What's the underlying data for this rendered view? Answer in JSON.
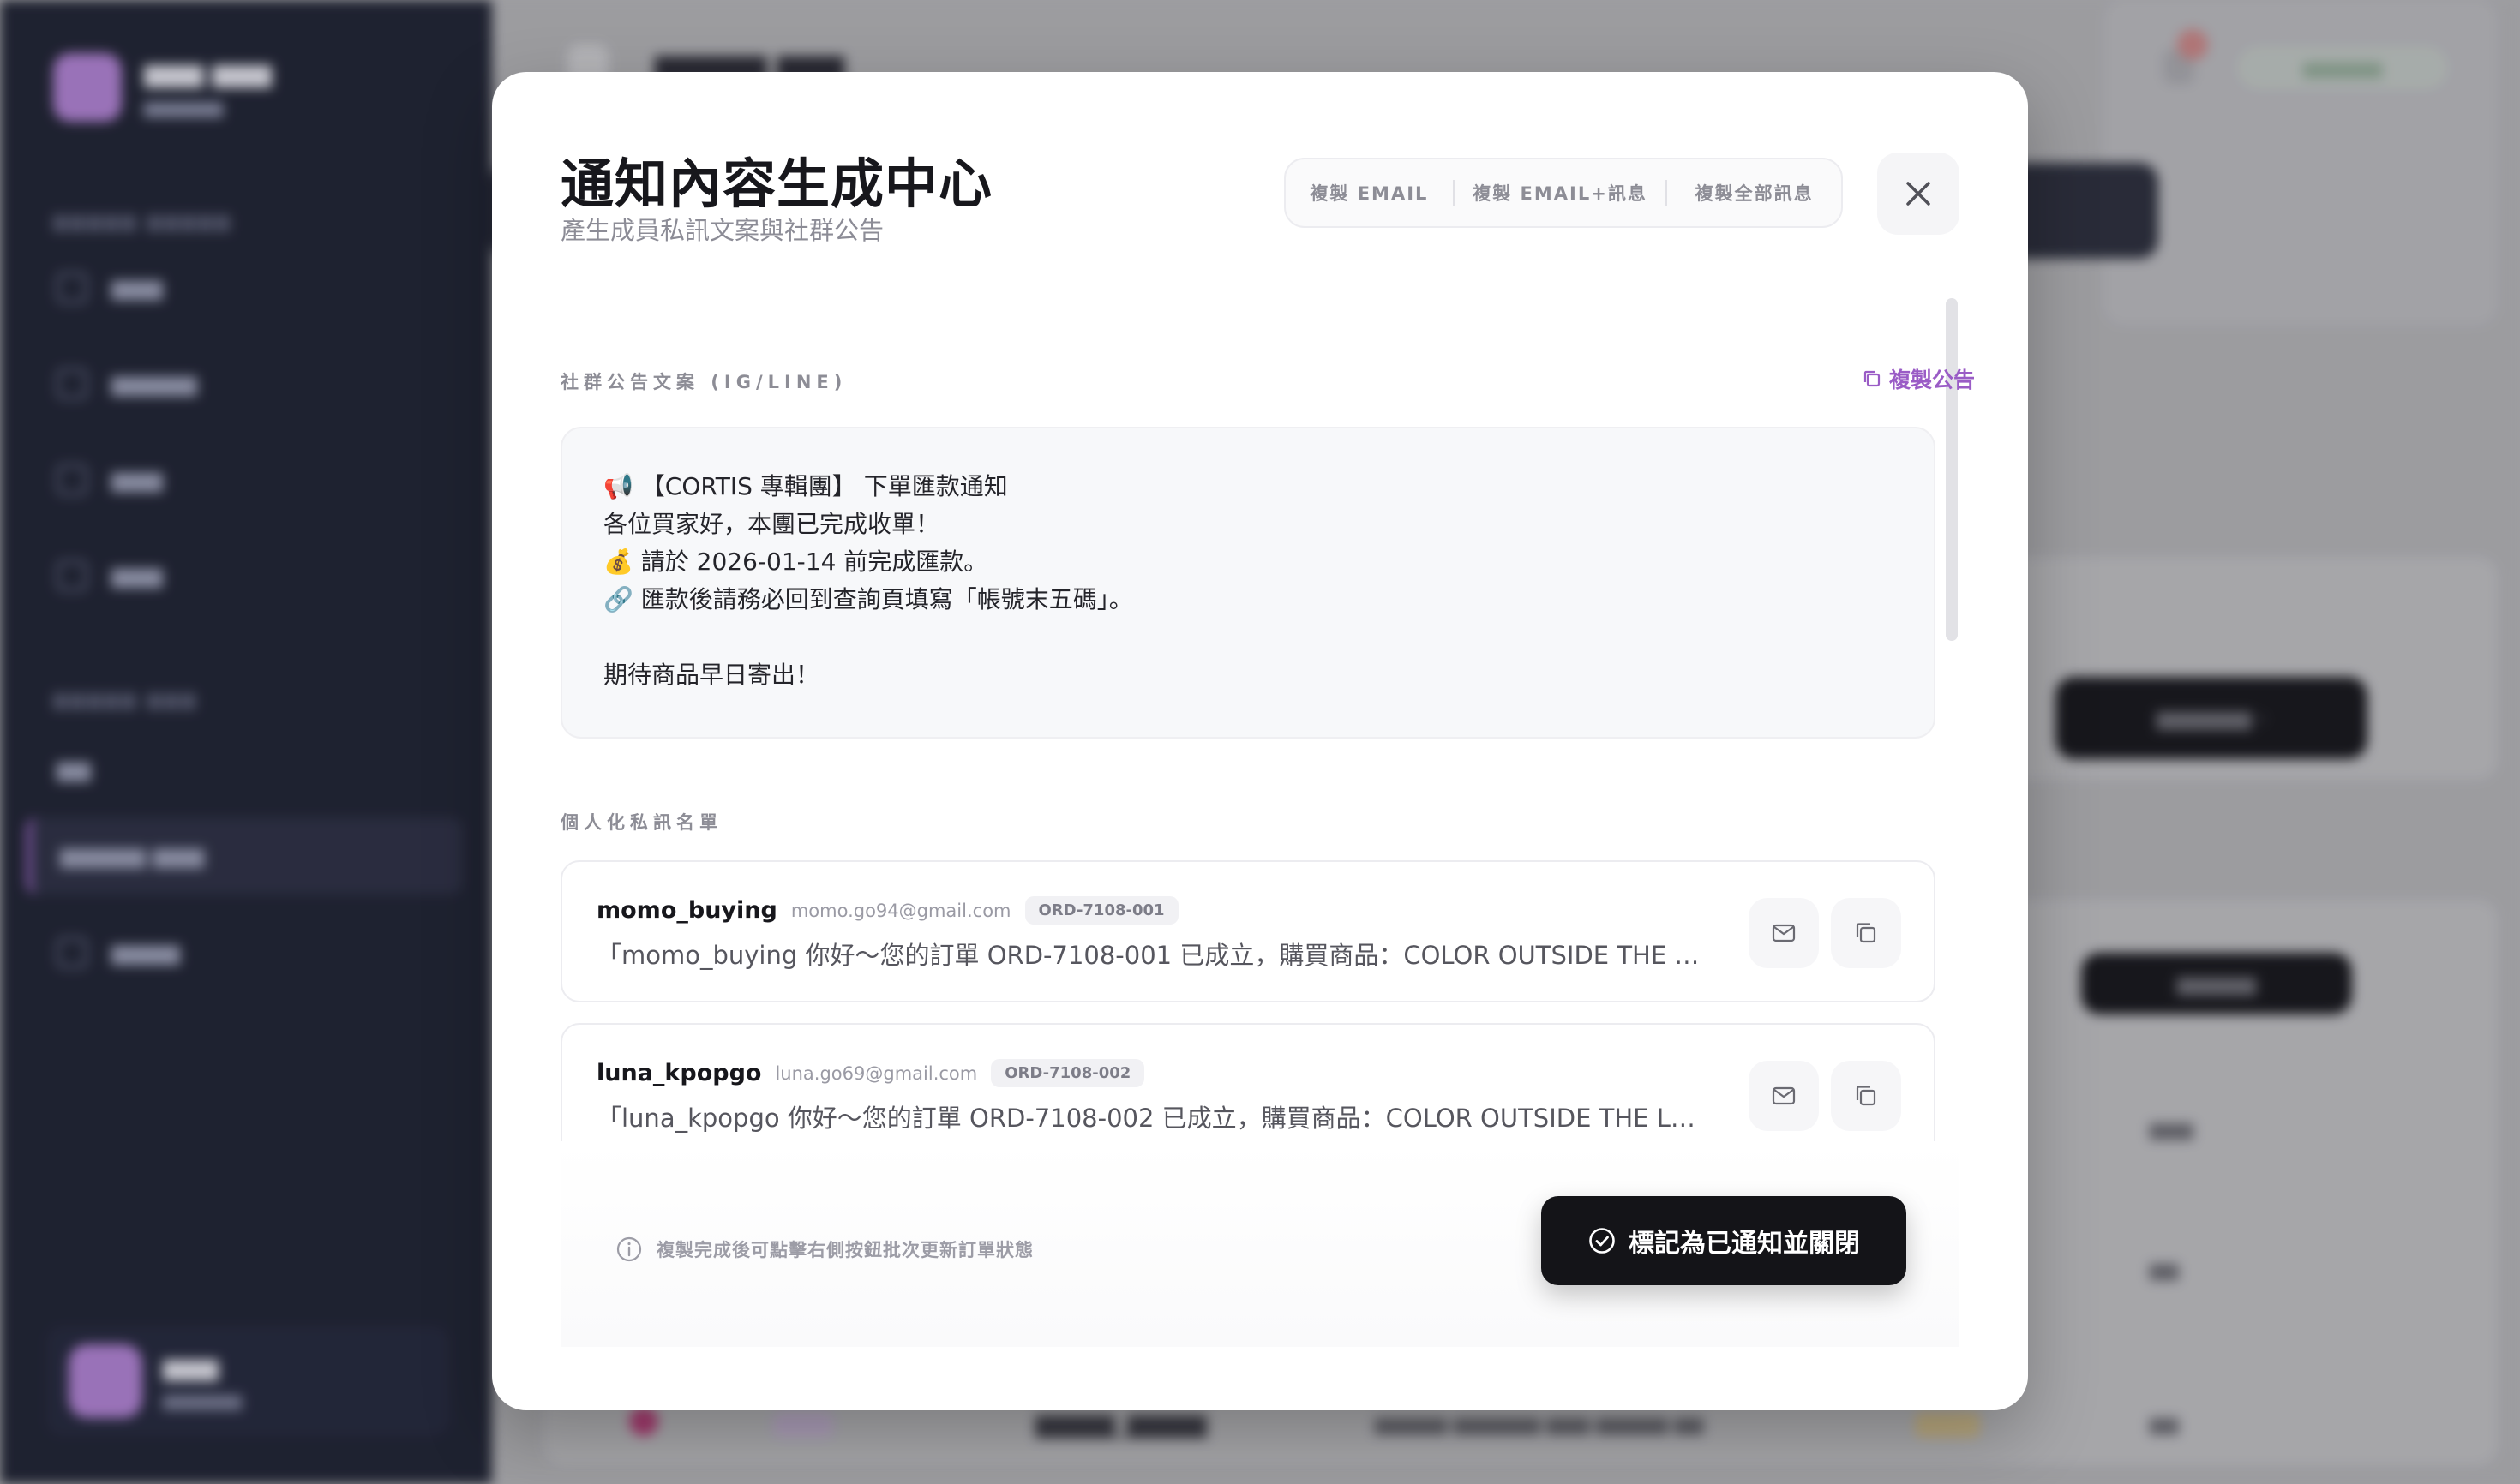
{
  "modal": {
    "title": "通知內容生成中心",
    "subtitle": "產生成員私訊文案與社群公告",
    "copy_email": "複製 EMAIL",
    "copy_email_msg": "複製 EMAIL+訊息",
    "copy_all": "複製全部訊息",
    "close_icon": "close-icon"
  },
  "announcement": {
    "section_label": "社群公告文案 (IG/LINE)",
    "copy_label": "複製公告",
    "lines": [
      "📢 【CORTIS 專輯團】 下單匯款通知",
      "各位買家好，本團已完成收單！",
      "💰 請於 2026-01-14 前完成匯款。",
      "🔗 匯款後請務必回到查詢頁填寫「帳號末五碼」。",
      "",
      "期待商品早日寄出！"
    ]
  },
  "messages": {
    "section_label": "個人化私訊名單",
    "items": [
      {
        "user": "momo_buying",
        "email": "momo.go94@gmail.com",
        "order": "ORD-7108-001",
        "body": "「momo_buying 你好～您的訂單 ORD-7108-001 已成立，購買商品：COLOR OUTSIDE THE LINES 專輯，請於期限內完成匯款。"
      },
      {
        "user": "luna_kpopgo",
        "email": "luna.go69@gmail.com",
        "order": "ORD-7108-002",
        "body": "「luna_kpopgo 你好～您的訂單 ORD-7108-002 已成立，購買商品：COLOR OUTSIDE THE LINES 專輯，請於期限內完成匯款。"
      }
    ]
  },
  "footer": {
    "info": "複製完成後可點擊右側按鈕批次更新訂單狀態",
    "confirm": "標記為已通知並關閉"
  },
  "colors": {
    "accent": "#9a5cc6",
    "primary_button": "#141418",
    "sidebar_bg": "#1d2130"
  }
}
